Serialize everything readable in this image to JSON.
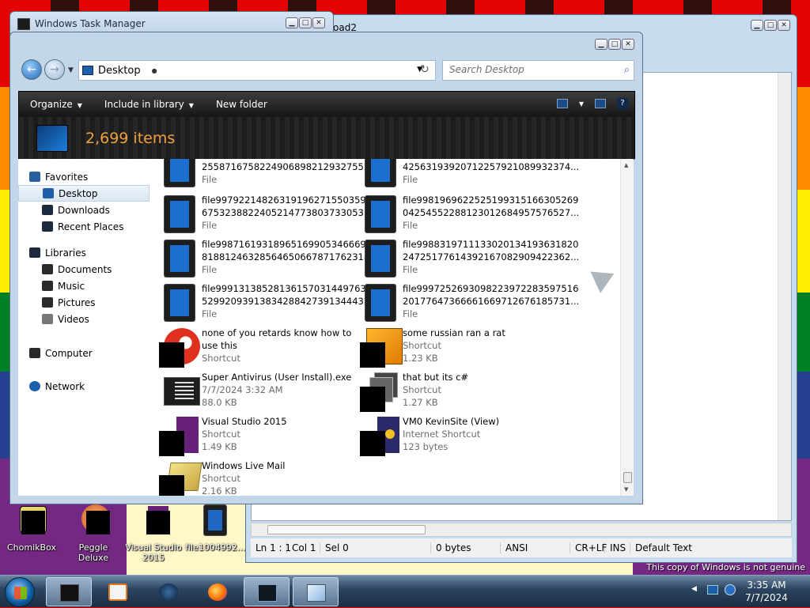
{
  "taskmgr": {
    "title": "Windows Task Manager"
  },
  "notepad": {
    "title": "oad2",
    "status": {
      "position": "Ln 1 : 1",
      "column": "Col 1",
      "selection": "Sel 0",
      "size": "0 bytes",
      "encoding": "ANSI",
      "line_ending": "CR+LF",
      "insert_mode": "INS",
      "style": "Default Text"
    }
  },
  "explorer": {
    "address": "Desktop",
    "search_placeholder": "Search Desktop",
    "commands": {
      "organize": "Organize",
      "include": "Include in library",
      "new_folder": "New folder"
    },
    "item_count": "2,699 items",
    "nav": {
      "favorites": "Favorites",
      "desktop": "Desktop",
      "downloads": "Downloads",
      "recent": "Recent Places",
      "libraries": "Libraries",
      "documents": "Documents",
      "music": "Music",
      "pictures": "Pictures",
      "videos": "Videos",
      "computer": "Computer",
      "network": "Network"
    },
    "items": [
      {
        "line1": "2558716758224906898212932755​2...",
        "line2": "File",
        "line3": ""
      },
      {
        "line1": "4256319392071225792108993237​4...",
        "line2": "File",
        "line3": ""
      },
      {
        "line1": "file99792214826319196271550359​97",
        "line2": "6753238822405214773803733053​1...",
        "line3": "File"
      },
      {
        "line1": "file99819696225251993151663052​69",
        "line2": "0425455228812301268495757652​7...",
        "line3": "File"
      },
      {
        "line1": "file99871619318965169905346669​71",
        "line2": "8188124632856465066787176231​8...",
        "line3": "File"
      },
      {
        "line1": "file99883197111330201341936318​20",
        "line2": "2472517761439216708290942236​2...",
        "line3": "File"
      },
      {
        "line1": "file99913138528136157031449763​83",
        "line2": "5299209391383428842739134443​2...",
        "line3": "File"
      },
      {
        "line1": "file99972526930982239722835975​16",
        "line2": "2017764736666166971267618573​1...",
        "line3": "File"
      },
      {
        "line1": "none of you retards know how to",
        "line2": "use this",
        "line3": "Shortcut"
      },
      {
        "line1": "some russian ran a rat",
        "line2": "Shortcut",
        "line3": "1.23 KB"
      },
      {
        "line1": "Super Antivirus (User Install).exe",
        "line2": "7/7/2024 3:32 AM",
        "line3": "88.0 KB"
      },
      {
        "line1": "that but its c#",
        "line2": "Shortcut",
        "line3": "1.27 KB"
      },
      {
        "line1": "Visual Studio 2015",
        "line2": "Shortcut",
        "line3": "1.49 KB"
      },
      {
        "line1": "VM0 KevinSite (View)",
        "line2": "Internet Shortcut",
        "line3": "123 bytes"
      },
      {
        "line1": "Windows Live Mail",
        "line2": "Shortcut",
        "line3": "2.16 KB"
      }
    ]
  },
  "desktop": {
    "icons": [
      {
        "label": "ChomikBox"
      },
      {
        "label": "Peggle Deluxe"
      },
      {
        "label": "Visual Studio 2015"
      },
      {
        "label": "file1004992..."
      }
    ],
    "watermark": "This copy of Windows is not genuine"
  },
  "tray": {
    "time": "3:35 AM",
    "date": "7/7/2024"
  },
  "colors": {
    "accent_orange": "#f0a040",
    "selection_blue": "#dbe6f3"
  }
}
